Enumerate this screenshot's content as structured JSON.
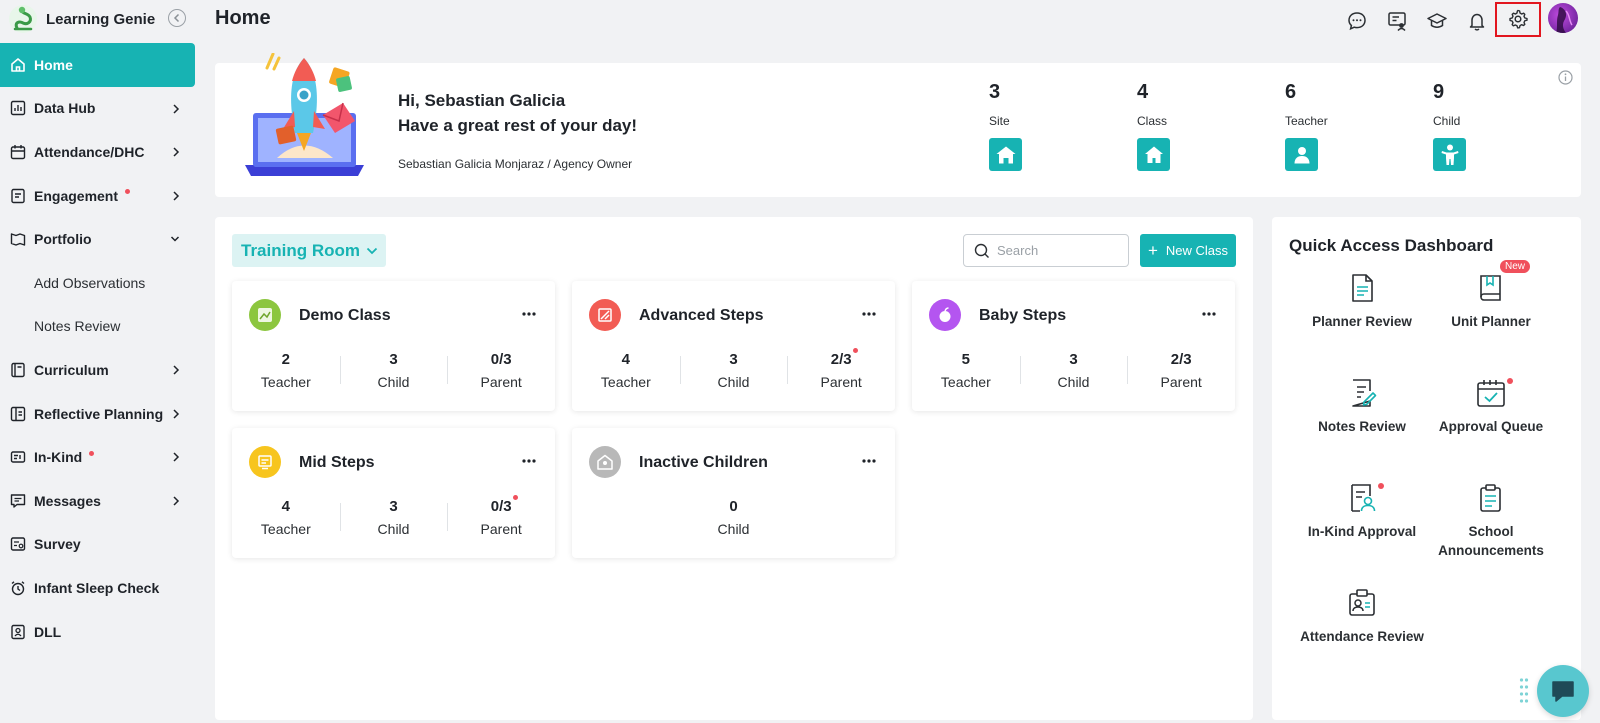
{
  "app": {
    "name": "Learning Genie"
  },
  "sidebar": {
    "items": [
      {
        "label": "Home",
        "icon": "home-icon"
      },
      {
        "label": "Data Hub",
        "icon": "bar-chart-icon"
      },
      {
        "label": "Attendance/DHC",
        "icon": "calendar-icon"
      },
      {
        "label": "Engagement",
        "icon": "engagement-icon"
      },
      {
        "label": "Portfolio",
        "icon": "portfolio-icon"
      },
      {
        "label": "Add Observations"
      },
      {
        "label": "Notes Review"
      },
      {
        "label": "Curriculum",
        "icon": "book-icon"
      },
      {
        "label": "Reflective Planning",
        "icon": "planning-icon"
      },
      {
        "label": "In-Kind",
        "icon": "in-kind-icon"
      },
      {
        "label": "Messages",
        "icon": "message-icon"
      },
      {
        "label": "Survey",
        "icon": "survey-icon"
      },
      {
        "label": "Infant Sleep Check",
        "icon": "alarm-clock-icon"
      },
      {
        "label": "DLL",
        "icon": "dll-icon"
      }
    ]
  },
  "header": {
    "title": "Home"
  },
  "welcome": {
    "greeting": "Hi, Sebastian Galicia",
    "message": "Have a great rest of your day!",
    "user_role": "Sebastian Galicia Monjaraz / Agency Owner",
    "stats": [
      {
        "value": "3",
        "label": "Site"
      },
      {
        "value": "4",
        "label": "Class"
      },
      {
        "value": "6",
        "label": "Teacher"
      },
      {
        "value": "9",
        "label": "Child"
      }
    ]
  },
  "main": {
    "room": "Training Room",
    "search_placeholder": "Search",
    "new_class_label": "New Class",
    "classes": [
      {
        "name": "Demo Class",
        "teacher": "2",
        "child": "3",
        "parent": "0/3",
        "color": "#8cc63f"
      },
      {
        "name": "Advanced Steps",
        "teacher": "4",
        "child": "3",
        "parent": "2/3",
        "color": "#f25c54"
      },
      {
        "name": "Baby Steps",
        "teacher": "5",
        "child": "3",
        "parent": "2/3",
        "color": "#b455f0"
      },
      {
        "name": "Mid Steps",
        "teacher": "4",
        "child": "3",
        "parent": "0/3",
        "color": "#f7c51e"
      },
      {
        "name": "Inactive Children",
        "child": "0",
        "color": "#b8b8b8"
      }
    ],
    "stat_labels": {
      "teacher": "Teacher",
      "child": "Child",
      "parent": "Parent"
    }
  },
  "quick_access": {
    "title": "Quick Access Dashboard",
    "new_badge": "New",
    "items": [
      {
        "label": "Planner Review"
      },
      {
        "label": "Unit Planner"
      },
      {
        "label": "Notes Review"
      },
      {
        "label": "Approval Queue"
      },
      {
        "label": "In-Kind Approval"
      },
      {
        "label": "School Announcements"
      },
      {
        "label": "Attendance Review"
      }
    ]
  },
  "colors": {
    "accent": "#17b3b3",
    "alert": "#f0505c",
    "highlight": "#e2161f"
  }
}
